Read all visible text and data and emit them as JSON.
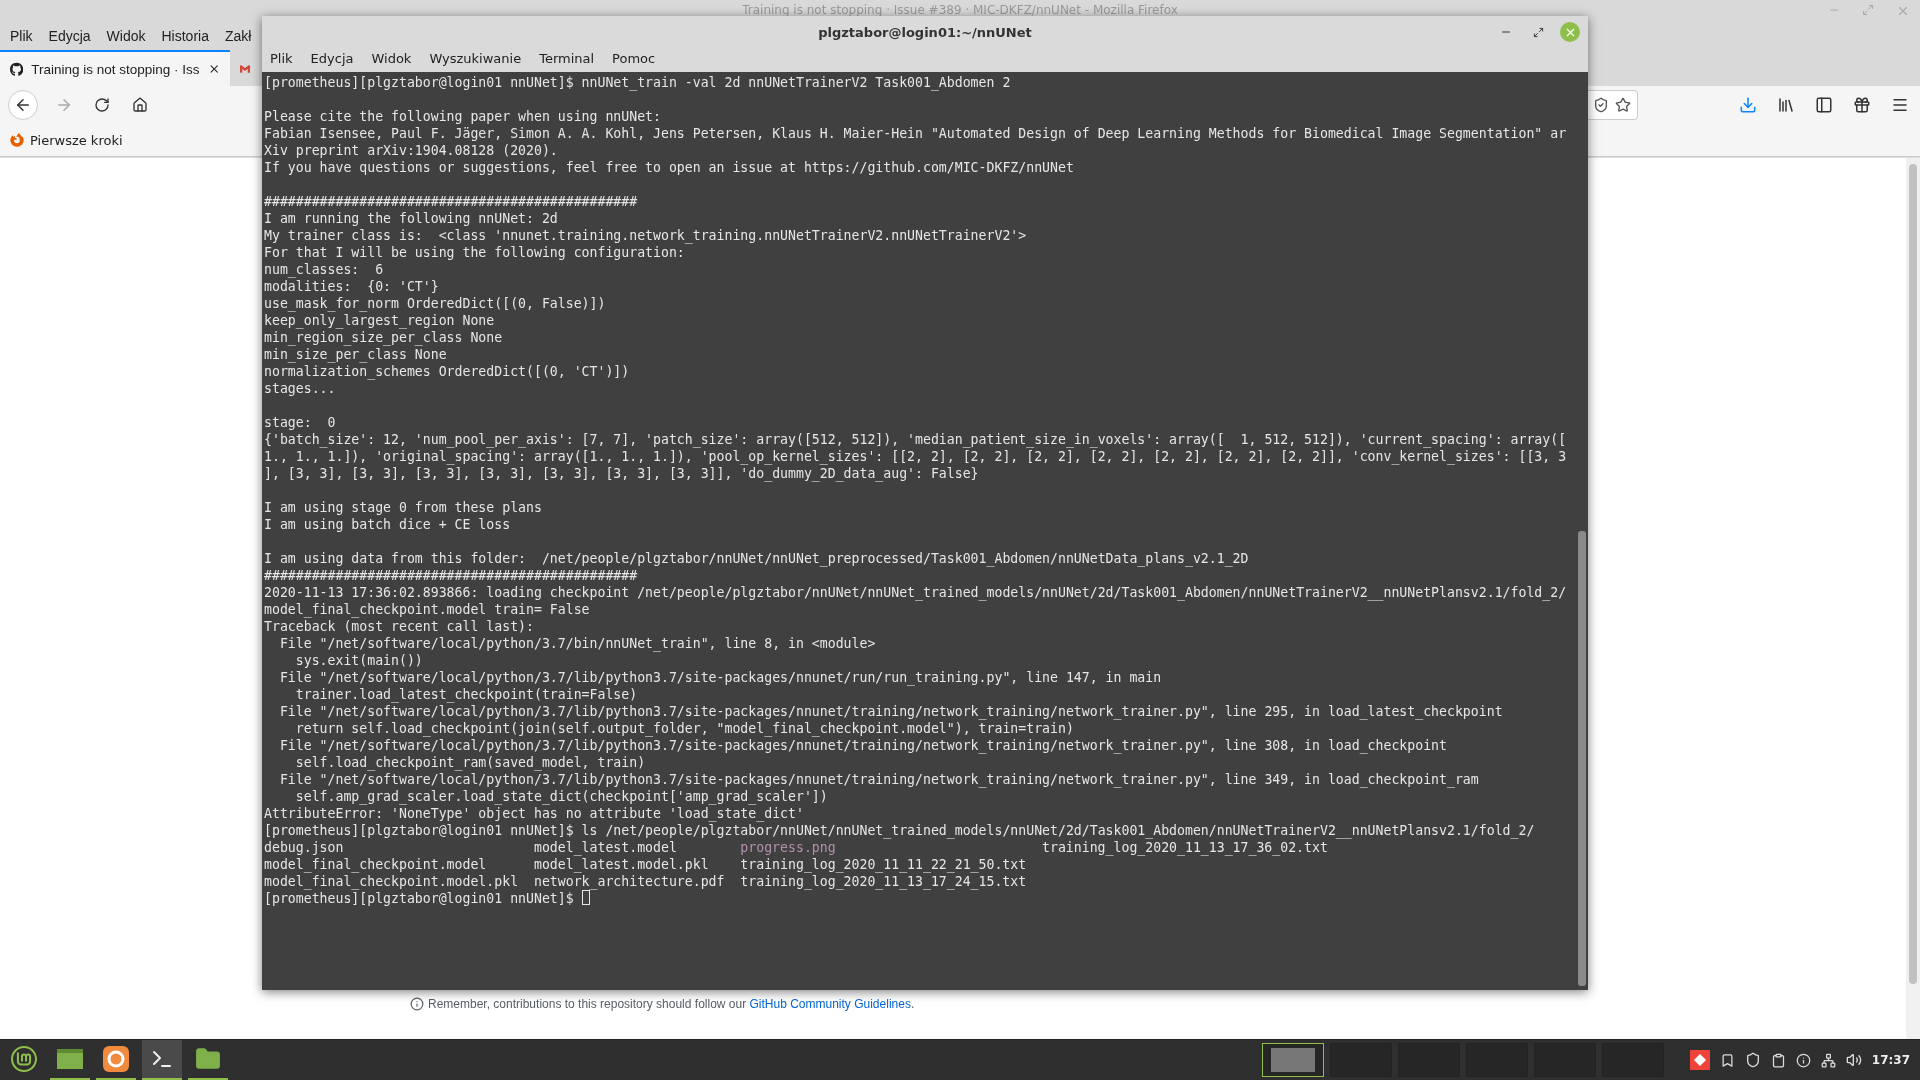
{
  "browser": {
    "title": "Training is not stopping · Issue #389 · MIC-DKFZ/nnUNet - Mozilla Firefox",
    "menu": [
      "Plik",
      "Edycja",
      "Widok",
      "Historia",
      "Zakł"
    ],
    "tabs": [
      {
        "kind": "github",
        "label": "Training is not stopping · Iss",
        "selected": true
      },
      {
        "kind": "mail",
        "selected": false
      }
    ],
    "bookmarks": [
      "Pierwsze kroki"
    ],
    "footer_note": {
      "text": "Remember, contributions to this repository should follow our",
      "link": "GitHub Community Guidelines",
      "after": "."
    }
  },
  "terminal": {
    "title": "plgztabor@login01:~/nnUNet",
    "menu": [
      "Plik",
      "Edycja",
      "Widok",
      "Wyszukiwanie",
      "Terminal",
      "Pomoc"
    ],
    "lines": [
      {
        "kind": "text",
        "text": "[prometheus][plgztabor@login01 nnUNet]$ nnUNet_train -val 2d nnUNetTrainerV2 Task001_Abdomen 2"
      },
      {
        "kind": "blank"
      },
      {
        "kind": "text",
        "text": "Please cite the following paper when using nnUNet:"
      },
      {
        "kind": "text",
        "text": "Fabian Isensee, Paul F. Jäger, Simon A. A. Kohl, Jens Petersen, Klaus H. Maier-Hein \"Automated Design of Deep Learning Methods for Biomedical Image Segmentation\" ar"
      },
      {
        "kind": "text",
        "text": "Xiv preprint arXiv:1904.08128 (2020)."
      },
      {
        "kind": "text",
        "text": "If you have questions or suggestions, feel free to open an issue at https://github.com/MIC-DKFZ/nnUNet"
      },
      {
        "kind": "blank"
      },
      {
        "kind": "text",
        "text": "###############################################"
      },
      {
        "kind": "text",
        "text": "I am running the following nnUNet: 2d"
      },
      {
        "kind": "text",
        "text": "My trainer class is:  <class 'nnunet.training.network_training.nnUNetTrainerV2.nnUNetTrainerV2'>"
      },
      {
        "kind": "text",
        "text": "For that I will be using the following configuration:"
      },
      {
        "kind": "text",
        "text": "num_classes:  6"
      },
      {
        "kind": "text",
        "text": "modalities:  {0: 'CT'}"
      },
      {
        "kind": "text",
        "text": "use_mask_for_norm OrderedDict([(0, False)])"
      },
      {
        "kind": "text",
        "text": "keep_only_largest_region None"
      },
      {
        "kind": "text",
        "text": "min_region_size_per_class None"
      },
      {
        "kind": "text",
        "text": "min_size_per_class None"
      },
      {
        "kind": "text",
        "text": "normalization_schemes OrderedDict([(0, 'CT')])"
      },
      {
        "kind": "text",
        "text": "stages..."
      },
      {
        "kind": "blank"
      },
      {
        "kind": "text",
        "text": "stage:  0"
      },
      {
        "kind": "text",
        "text": "{'batch_size': 12, 'num_pool_per_axis': [7, 7], 'patch_size': array([512, 512]), 'median_patient_size_in_voxels': array([  1, 512, 512]), 'current_spacing': array(["
      },
      {
        "kind": "text",
        "text": "1., 1., 1.]), 'original_spacing': array([1., 1., 1.]), 'pool_op_kernel_sizes': [[2, 2], [2, 2], [2, 2], [2, 2], [2, 2], [2, 2], [2, 2]], 'conv_kernel_sizes': [[3, 3"
      },
      {
        "kind": "text",
        "text": "], [3, 3], [3, 3], [3, 3], [3, 3], [3, 3], [3, 3], [3, 3]], 'do_dummy_2D_data_aug': False}"
      },
      {
        "kind": "blank"
      },
      {
        "kind": "text",
        "text": "I am using stage 0 from these plans"
      },
      {
        "kind": "text",
        "text": "I am using batch dice + CE loss"
      },
      {
        "kind": "blank"
      },
      {
        "kind": "text",
        "text": "I am using data from this folder:  /net/people/plgztabor/nnUNet/nnUNet_preprocessed/Task001_Abdomen/nnUNetData_plans_v2.1_2D"
      },
      {
        "kind": "text",
        "text": "###############################################"
      },
      {
        "kind": "text",
        "text": "2020-11-13 17:36:02.893866: loading checkpoint /net/people/plgztabor/nnUNet/nnUNet_trained_models/nnUNet/2d/Task001_Abdomen/nnUNetTrainerV2__nnUNetPlansv2.1/fold_2/"
      },
      {
        "kind": "text",
        "text": "model_final_checkpoint.model train= False"
      },
      {
        "kind": "text",
        "text": "Traceback (most recent call last):"
      },
      {
        "kind": "text",
        "text": "  File \"/net/software/local/python/3.7/bin/nnUNet_train\", line 8, in <module>"
      },
      {
        "kind": "text",
        "text": "    sys.exit(main())"
      },
      {
        "kind": "text",
        "text": "  File \"/net/software/local/python/3.7/lib/python3.7/site-packages/nnunet/run/run_training.py\", line 147, in main"
      },
      {
        "kind": "text",
        "text": "    trainer.load_latest_checkpoint(train=False)"
      },
      {
        "kind": "text",
        "text": "  File \"/net/software/local/python/3.7/lib/python3.7/site-packages/nnunet/training/network_training/network_trainer.py\", line 295, in load_latest_checkpoint"
      },
      {
        "kind": "text",
        "text": "    return self.load_checkpoint(join(self.output_folder, \"model_final_checkpoint.model\"), train=train)"
      },
      {
        "kind": "text",
        "text": "  File \"/net/software/local/python/3.7/lib/python3.7/site-packages/nnunet/training/network_training/network_trainer.py\", line 308, in load_checkpoint"
      },
      {
        "kind": "text",
        "text": "    self.load_checkpoint_ram(saved_model, train)"
      },
      {
        "kind": "text",
        "text": "  File \"/net/software/local/python/3.7/lib/python3.7/site-packages/nnunet/training/network_training/network_trainer.py\", line 349, in load_checkpoint_ram"
      },
      {
        "kind": "text",
        "text": "    self.amp_grad_scaler.load_state_dict(checkpoint['amp_grad_scaler'])"
      },
      {
        "kind": "text",
        "text": "AttributeError: 'NoneType' object has no attribute 'load_state_dict'"
      },
      {
        "kind": "text",
        "text": "[prometheus][plgztabor@login01 nnUNet]$ ls /net/people/plgztabor/nnUNet/nnUNet_trained_models/nnUNet/2d/Task001_Abdomen/nnUNetTrainerV2__nnUNetPlansv2.1/fold_2/"
      },
      {
        "kind": "listing",
        "rows": [
          [
            {
              "text": "debug.json",
              "kind": "file"
            },
            {
              "text": "model_latest.model",
              "kind": "file"
            },
            {
              "text": "progress.png",
              "kind": "image"
            },
            {
              "text": "training_log_2020_11_13_17_36_02.txt",
              "kind": "file"
            }
          ],
          [
            {
              "text": "model_final_checkpoint.model",
              "kind": "file"
            },
            {
              "text": "model_latest.model.pkl",
              "kind": "file"
            },
            {
              "text": "training_log_2020_11_11_22_21_50.txt",
              "kind": "file"
            }
          ],
          [
            {
              "text": "model_final_checkpoint.model.pkl",
              "kind": "file"
            },
            {
              "text": "network_architecture.pdf",
              "kind": "file"
            },
            {
              "text": "training_log_2020_11_13_17_24_15.txt",
              "kind": "file"
            }
          ]
        ]
      },
      {
        "kind": "prompt",
        "text": "[prometheus][plgztabor@login01 nnUNet]$",
        "cursor": true
      }
    ]
  },
  "taskbar": {
    "launchers": [
      {
        "kind": "menu",
        "selected": false,
        "running": false
      },
      {
        "kind": "files",
        "selected": false,
        "running": true
      },
      {
        "kind": "firefox",
        "selected": false,
        "running": true
      },
      {
        "kind": "terminal",
        "selected": true,
        "running": true
      },
      {
        "kind": "folder",
        "selected": false,
        "running": true
      }
    ],
    "workspaces": [
      {
        "selected": true
      },
      {
        "selected": false
      },
      {
        "selected": false
      },
      {
        "selected": false
      },
      {
        "selected": false
      },
      {
        "selected": false
      }
    ],
    "clock": "17:37"
  }
}
